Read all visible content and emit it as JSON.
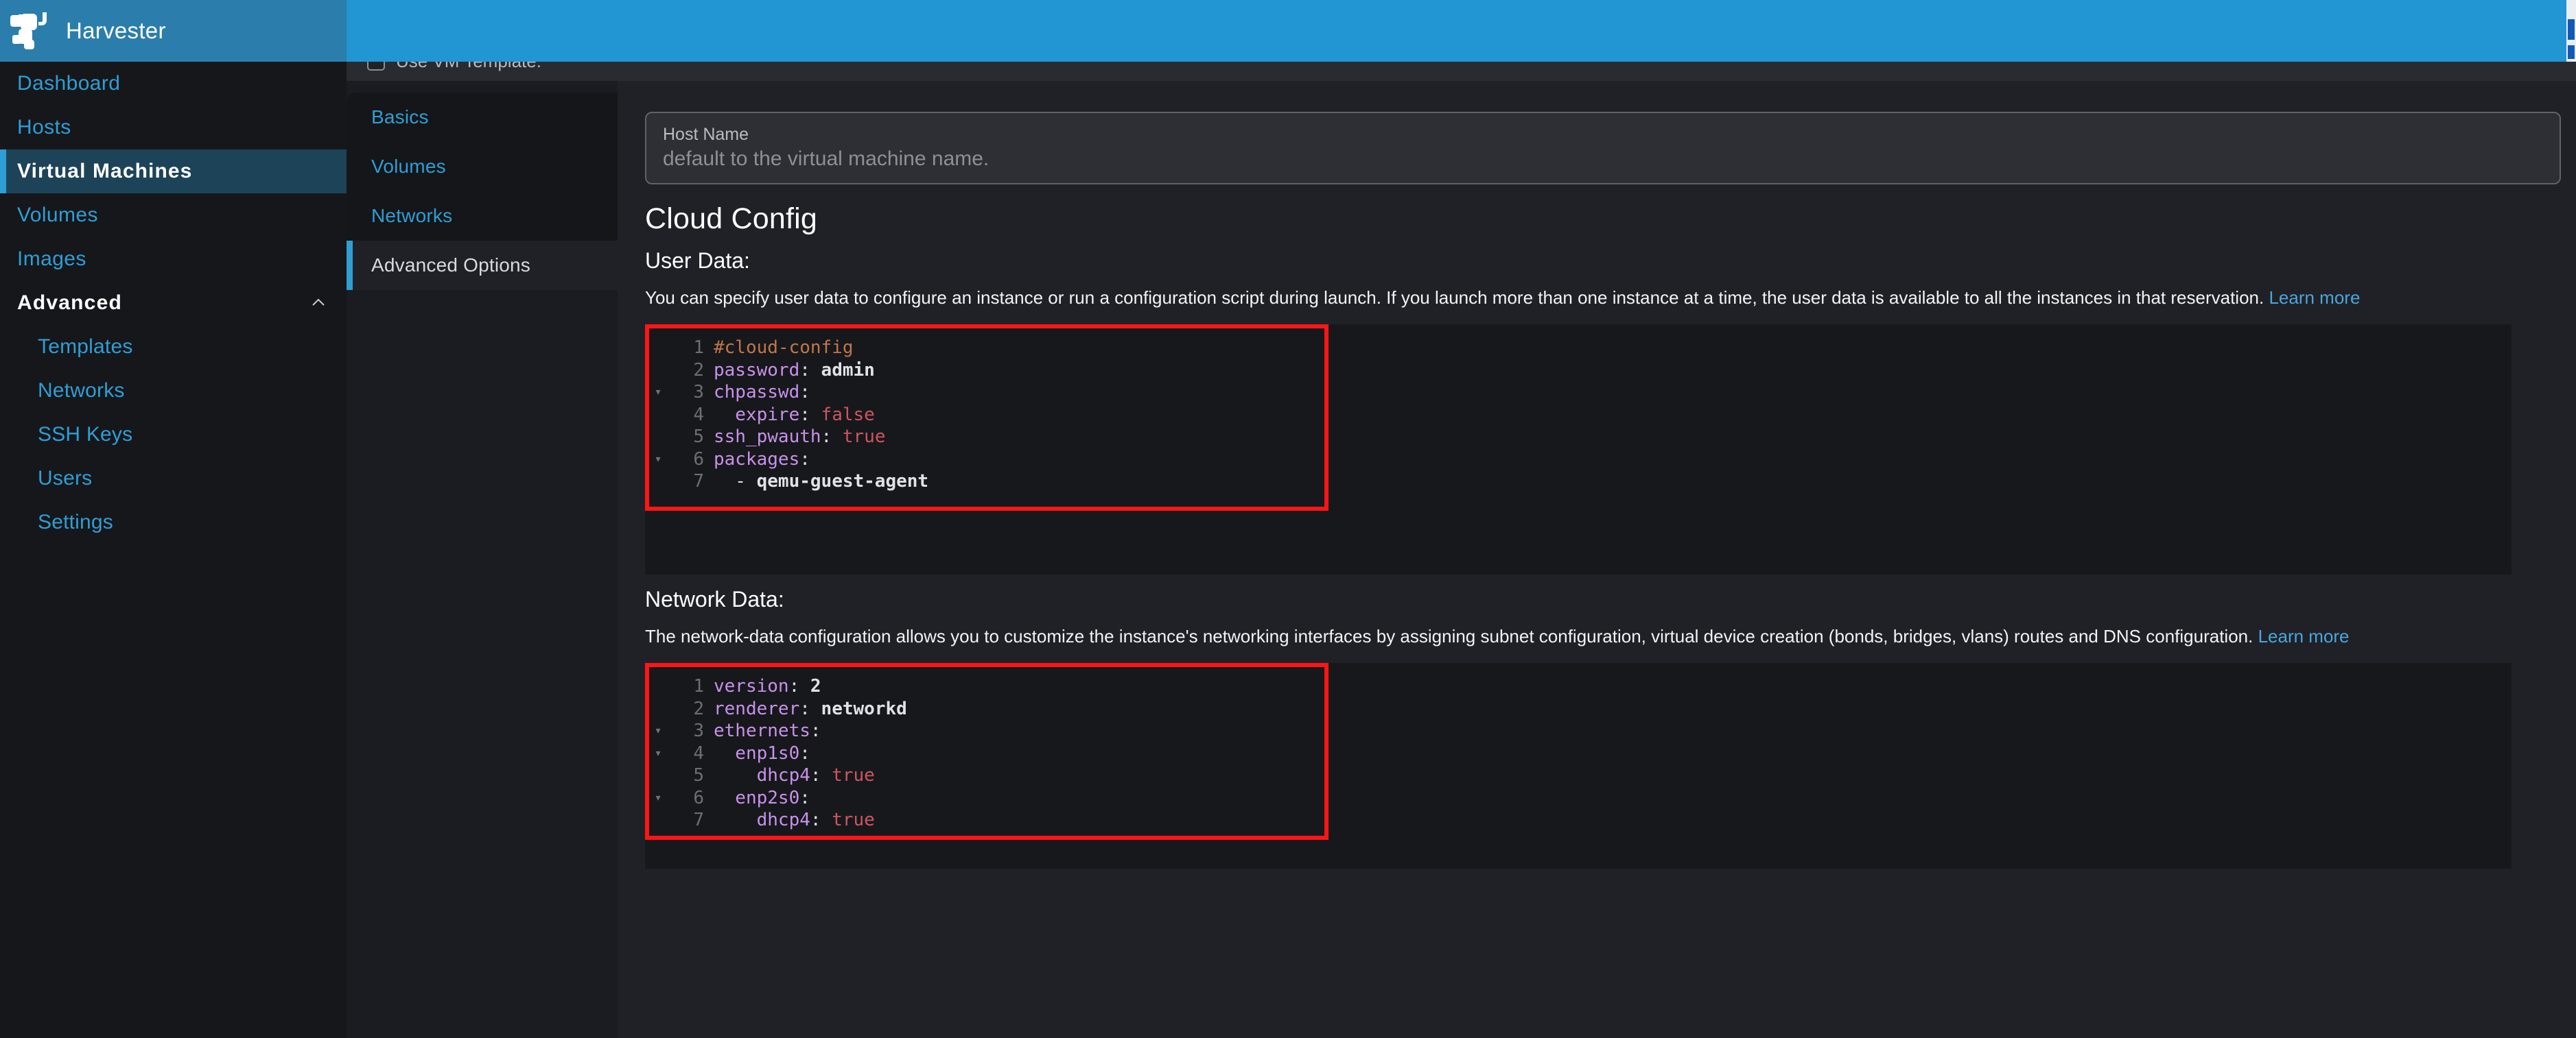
{
  "brand": {
    "name": "Harvester",
    "logo_icon": "harvester-bull-logo"
  },
  "sidebar": {
    "items": [
      {
        "label": "Dashboard",
        "type": "link",
        "active": false
      },
      {
        "label": "Hosts",
        "type": "link",
        "active": false
      },
      {
        "label": "Virtual Machines",
        "type": "link",
        "active": true
      },
      {
        "label": "Volumes",
        "type": "link",
        "active": false
      },
      {
        "label": "Images",
        "type": "link",
        "active": false
      },
      {
        "label": "Advanced",
        "type": "group",
        "active": false,
        "chevron": "chevron-up-icon"
      },
      {
        "label": "Templates",
        "type": "sub",
        "active": false
      },
      {
        "label": "Networks",
        "type": "sub",
        "active": false
      },
      {
        "label": "SSH Keys",
        "type": "sub",
        "active": false
      },
      {
        "label": "Users",
        "type": "sub",
        "active": false
      },
      {
        "label": "Settings",
        "type": "sub",
        "active": false
      }
    ]
  },
  "form": {
    "use_vm_template_label": "Use VM Template:",
    "tabs": [
      {
        "label": "Basics",
        "active": false
      },
      {
        "label": "Volumes",
        "active": false
      },
      {
        "label": "Networks",
        "active": false
      },
      {
        "label": "Advanced Options",
        "active": true
      }
    ],
    "host_name": {
      "label": "Host Name",
      "value": "",
      "placeholder": "default to the virtual machine name."
    }
  },
  "cloud_config": {
    "heading": "Cloud Config",
    "user_data": {
      "heading": "User Data:",
      "description": "You can specify user data to configure an instance or run a configuration script during launch. If you launch more than one instance at a time, the user data is available to all the instances in that reservation. ",
      "learn_more": "Learn more",
      "lines": [
        {
          "n": "1",
          "fold": "",
          "tokens": [
            {
              "t": "#cloud-config",
              "c": "cm"
            }
          ]
        },
        {
          "n": "2",
          "fold": "",
          "tokens": [
            {
              "t": "password",
              "c": "k"
            },
            {
              "t": ": ",
              "c": "pn"
            },
            {
              "t": "admin",
              "c": "b"
            }
          ]
        },
        {
          "n": "3",
          "fold": "▾",
          "tokens": [
            {
              "t": "chpasswd",
              "c": "k"
            },
            {
              "t": ":",
              "c": "pn"
            }
          ]
        },
        {
          "n": "4",
          "fold": "",
          "tokens": [
            {
              "t": "  expire",
              "c": "k"
            },
            {
              "t": ": ",
              "c": "pn"
            },
            {
              "t": "false",
              "c": "bo"
            }
          ]
        },
        {
          "n": "5",
          "fold": "",
          "tokens": [
            {
              "t": "ssh_pwauth",
              "c": "k"
            },
            {
              "t": ": ",
              "c": "pn"
            },
            {
              "t": "true",
              "c": "bo"
            }
          ]
        },
        {
          "n": "6",
          "fold": "▾",
          "tokens": [
            {
              "t": "packages",
              "c": "k"
            },
            {
              "t": ":",
              "c": "pn"
            }
          ]
        },
        {
          "n": "7",
          "fold": "",
          "tokens": [
            {
              "t": "  - ",
              "c": "src"
            },
            {
              "t": "qemu-guest-agent",
              "c": "b"
            }
          ]
        }
      ]
    },
    "network_data": {
      "heading": "Network Data:",
      "description": "The network-data configuration allows you to customize the instance's networking interfaces by assigning subnet configuration, virtual device creation (bonds, bridges, vlans) routes and DNS configuration. ",
      "learn_more": "Learn more",
      "lines": [
        {
          "n": "1",
          "fold": "",
          "tokens": [
            {
              "t": "version",
              "c": "k"
            },
            {
              "t": ": ",
              "c": "pn"
            },
            {
              "t": "2",
              "c": "b"
            }
          ]
        },
        {
          "n": "2",
          "fold": "",
          "tokens": [
            {
              "t": "renderer",
              "c": "k"
            },
            {
              "t": ": ",
              "c": "pn"
            },
            {
              "t": "networkd",
              "c": "b"
            }
          ]
        },
        {
          "n": "3",
          "fold": "▾",
          "tokens": [
            {
              "t": "ethernets",
              "c": "k"
            },
            {
              "t": ":",
              "c": "pn"
            }
          ]
        },
        {
          "n": "4",
          "fold": "▾",
          "tokens": [
            {
              "t": "  enp1s0",
              "c": "k"
            },
            {
              "t": ":",
              "c": "pn"
            }
          ]
        },
        {
          "n": "5",
          "fold": "",
          "tokens": [
            {
              "t": "    dhcp4",
              "c": "k"
            },
            {
              "t": ": ",
              "c": "pn"
            },
            {
              "t": "true",
              "c": "bo"
            }
          ]
        },
        {
          "n": "6",
          "fold": "▾",
          "tokens": [
            {
              "t": "  enp2s0",
              "c": "k"
            },
            {
              "t": ":",
              "c": "pn"
            }
          ]
        },
        {
          "n": "7",
          "fold": "",
          "tokens": [
            {
              "t": "    dhcp4",
              "c": "k"
            },
            {
              "t": ": ",
              "c": "pn"
            },
            {
              "t": "true",
              "c": "bo"
            }
          ]
        }
      ]
    }
  },
  "colors": {
    "brand_blue": "#2b7eab",
    "topbar_blue": "#2196d3",
    "accent_link": "#2f9ed4",
    "sidebar_bg": "#16171b",
    "content_bg": "#202127",
    "editor_bg": "#17181c",
    "highlight_box": "#ff1515",
    "active_nav_bg": "#1d4359"
  }
}
